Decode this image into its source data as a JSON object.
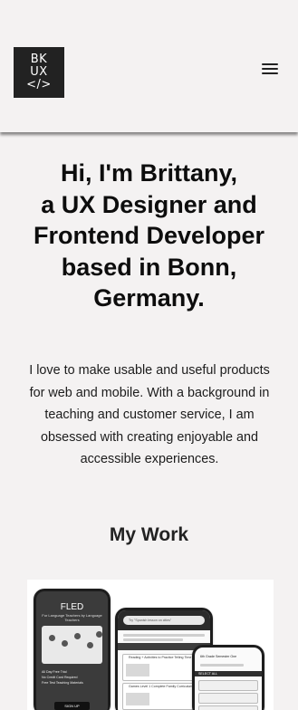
{
  "header": {
    "logo_lines": [
      "BK",
      "UX",
      "</>"
    ]
  },
  "hero": {
    "title_lines": [
      "Hi, I'm Brittany,",
      "a UX Designer and",
      "Frontend Developer",
      "based in Bonn,",
      "Germany."
    ],
    "bio_lines": [
      "I love to make usable and useful products",
      "for web and mobile. With a background in",
      "teaching and customer service, I am",
      "obsessed with creating enjoyable and",
      "accessible experiences."
    ]
  },
  "work": {
    "section_title": "My Work",
    "mockup": {
      "fled_title": "FLED",
      "fled_subtitle": "For Language Teachers by Language Teachers",
      "fled_list": [
        "All Day Free Trial",
        "No Credit Card Required",
        "Free Test Teaching Materials"
      ],
      "fled_button": "SIGN UP",
      "search_placeholder": "Try \"Spanish lesson on cities\"",
      "result_title_1": "Reading + Activities to Practice Telling Time in Spanish",
      "result_title_2": "Games Level 1 Complete Family Curriculum",
      "phone3_header": "6th Grade Semester One",
      "phone3_bar": "SELECT ALL"
    }
  },
  "colors": {
    "page_background": "#f4f2f2",
    "logo_background": "#222222",
    "text_primary": "#0d0d0d"
  }
}
